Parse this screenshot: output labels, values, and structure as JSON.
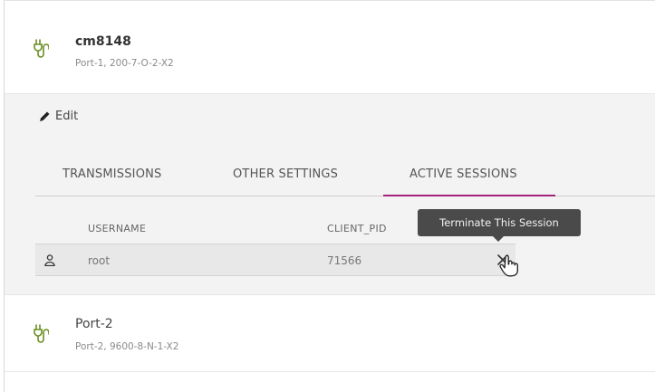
{
  "device": {
    "name": "cm8148",
    "subtitle": "Port-1, 200-7-O-2-X2"
  },
  "panel": {
    "edit_label": "Edit",
    "tabs": [
      {
        "label": "TRANSMISSIONS"
      },
      {
        "label": "OTHER SETTINGS"
      },
      {
        "label": "ACTIVE SESSIONS",
        "active": true
      }
    ],
    "columns": {
      "username": "USERNAME",
      "client_pid": "CLIENT_PID"
    },
    "sessions": [
      {
        "username": "root",
        "client_pid": "71566"
      }
    ],
    "tooltip": "Terminate This Session"
  },
  "port2": {
    "name": "Port-2",
    "subtitle": "Port-2, 9600-8-N-1-X2"
  },
  "colors": {
    "accent": "#a4237a",
    "icon_green": "#6b8e23",
    "tooltip_bg": "#4a4a4a"
  }
}
